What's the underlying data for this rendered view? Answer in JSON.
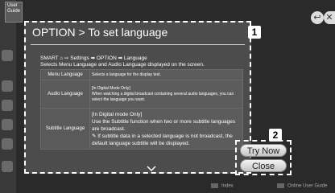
{
  "app": {
    "badge": "User Guide"
  },
  "panel": {
    "title": "OPTION > To set language",
    "callout_1": "1",
    "breadcrumb": "SMART ⌂ ⇨ Settings ➡ OPTION ➡ Language",
    "instructions": "Selects Menu Language and Audio Language displayed on the screen.",
    "rows": [
      {
        "name": "Menu Language",
        "desc": "Selects a language for the display text."
      },
      {
        "name": "Audio Language",
        "desc": "[In Digital Mode Only]\nWhen watching a digital broadcast containing several audio languages, you can select the language you want."
      },
      {
        "name": "Subtitle Language",
        "desc": "[In Digital mode Only]\nUse the Subtitle function when two or more subtitle languages are broadcast.\n✎ If subtitle data in a selected language is not broadcast, the default language subtitle will be displayed."
      }
    ]
  },
  "buttons": {
    "callout_2": "2",
    "try_now": "Try Now",
    "close": "Close"
  },
  "top": {
    "back_glyph": "↩",
    "close_glyph": "✕"
  },
  "footer": {
    "index": "Index",
    "online": "Online User Guide"
  }
}
